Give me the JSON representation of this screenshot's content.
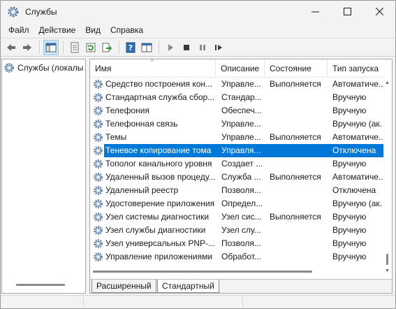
{
  "window": {
    "title": "Службы",
    "icon": "gear-icon"
  },
  "menu": [
    "Файл",
    "Действие",
    "Вид",
    "Справка"
  ],
  "toolbar": {
    "buttons": [
      "back-icon",
      "forward-icon",
      "console-tree-icon",
      "properties-icon",
      "refresh-icon",
      "export-icon",
      "help-icon",
      "view-icon",
      "start-service-icon",
      "stop-service-icon",
      "pause-service-icon",
      "restart-service-icon"
    ]
  },
  "tree": {
    "root_label": "Службы (локалы"
  },
  "list": {
    "columns": [
      "Имя",
      "Описание",
      "Состояние",
      "Тип запуска"
    ],
    "rows": [
      {
        "name": "Средство построения кон...",
        "desc": "Управле...",
        "state": "Выполняется",
        "start": "Автоматиче..."
      },
      {
        "name": "Стандартная служба сбор...",
        "desc": "Стандар...",
        "state": "",
        "start": "Вручную"
      },
      {
        "name": "Телефония",
        "desc": "Обеспеч...",
        "state": "",
        "start": "Вручную"
      },
      {
        "name": "Телефонная связь",
        "desc": "Управле...",
        "state": "",
        "start": "Вручную (ак."
      },
      {
        "name": "Темы",
        "desc": "Управле...",
        "state": "Выполняется",
        "start": "Автоматиче..."
      },
      {
        "name": "Теневое копирование тома",
        "desc": "Управля...",
        "state": "",
        "start": "Отключена",
        "selected": true
      },
      {
        "name": "Тополог канального уровня",
        "desc": "Создает ...",
        "state": "",
        "start": "Вручную"
      },
      {
        "name": "Удаленный вызов процеду...",
        "desc": "Служба ...",
        "state": "Выполняется",
        "start": "Автоматиче..."
      },
      {
        "name": "Удаленный реестр",
        "desc": "Позволя...",
        "state": "",
        "start": "Отключена"
      },
      {
        "name": "Удостоверение приложения",
        "desc": "Определ...",
        "state": "",
        "start": "Вручную (ак."
      },
      {
        "name": "Узел системы диагностики",
        "desc": "Узел сис...",
        "state": "Выполняется",
        "start": "Вручную"
      },
      {
        "name": "Узел службы диагностики",
        "desc": "Узел слу...",
        "state": "",
        "start": "Вручную"
      },
      {
        "name": "Узел универсальных PNP-...",
        "desc": "Позволя...",
        "state": "",
        "start": "Вручную"
      },
      {
        "name": "Управление приложениями",
        "desc": "Обработ...",
        "state": "",
        "start": "Вручную"
      }
    ]
  },
  "tabs": [
    "Расширенный",
    "Стандартный"
  ],
  "colors": {
    "selection": "#0078d7",
    "selection_text": "#ffffff"
  }
}
